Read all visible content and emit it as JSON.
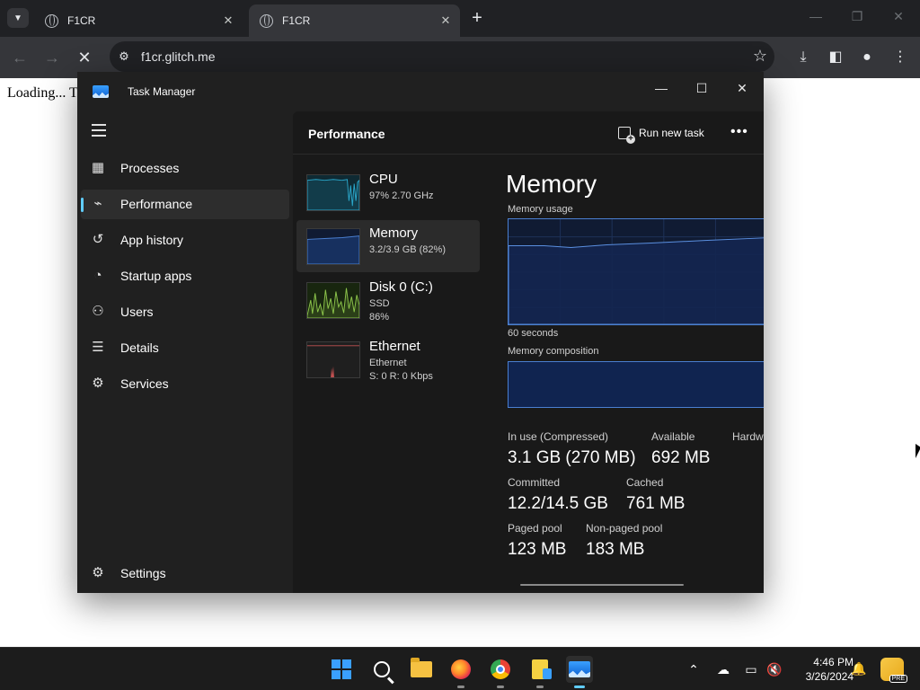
{
  "browser": {
    "tabs": [
      {
        "title": "F1CR",
        "active": false
      },
      {
        "title": "F1CR",
        "active": true
      }
    ],
    "url": "f1cr.glitch.me",
    "page_text": "Loading... T"
  },
  "task_manager": {
    "window_title": "Task Manager",
    "nav": [
      {
        "label": "Processes",
        "icon": "processes-icon"
      },
      {
        "label": "Performance",
        "icon": "performance-icon",
        "selected": true
      },
      {
        "label": "App history",
        "icon": "history-icon"
      },
      {
        "label": "Startup apps",
        "icon": "startup-icon"
      },
      {
        "label": "Users",
        "icon": "users-icon"
      },
      {
        "label": "Details",
        "icon": "details-icon"
      },
      {
        "label": "Services",
        "icon": "services-icon"
      }
    ],
    "settings_label": "Settings",
    "page_title": "Performance",
    "run_new_task": "Run new task",
    "resources": [
      {
        "name": "CPU",
        "line1": "97%  2.70 GHz",
        "line2": "",
        "color": "#2aa6c9"
      },
      {
        "name": "Memory",
        "line1": "3.2/3.9 GB (82%)",
        "line2": "",
        "color": "#4a7fd0",
        "selected": true
      },
      {
        "name": "Disk 0 (C:)",
        "line1": "SSD",
        "line2": "86%",
        "color": "#8bc34a"
      },
      {
        "name": "Ethernet",
        "line1": "Ethernet",
        "line2": "S: 0  R: 0 Kbps",
        "color": "#c05050"
      }
    ],
    "detail": {
      "title": "Memory",
      "usage_label": "Memory usage",
      "time_label": "60 seconds",
      "composition_label": "Memory composition",
      "stats": [
        {
          "label": "In use (Compressed)",
          "value": "3.1 GB (270 MB)"
        },
        {
          "label": "Available",
          "value": "692 MB"
        },
        {
          "label": "Hardw",
          "value": ""
        },
        {
          "label": "Committed",
          "value": "12.2/14.5 GB"
        },
        {
          "label": "Cached",
          "value": "761 MB"
        },
        {
          "label": "Paged pool",
          "value": "123 MB"
        },
        {
          "label": "Non-paged pool",
          "value": "183 MB"
        }
      ]
    }
  },
  "taskbar": {
    "apps": [
      "start-icon",
      "search-icon",
      "file-explorer-icon",
      "firefox-icon",
      "chrome-icon",
      "notes-icon",
      "task-manager-icon"
    ],
    "time": "4:46 PM",
    "date": "3/26/2024",
    "badge": "PRE"
  }
}
